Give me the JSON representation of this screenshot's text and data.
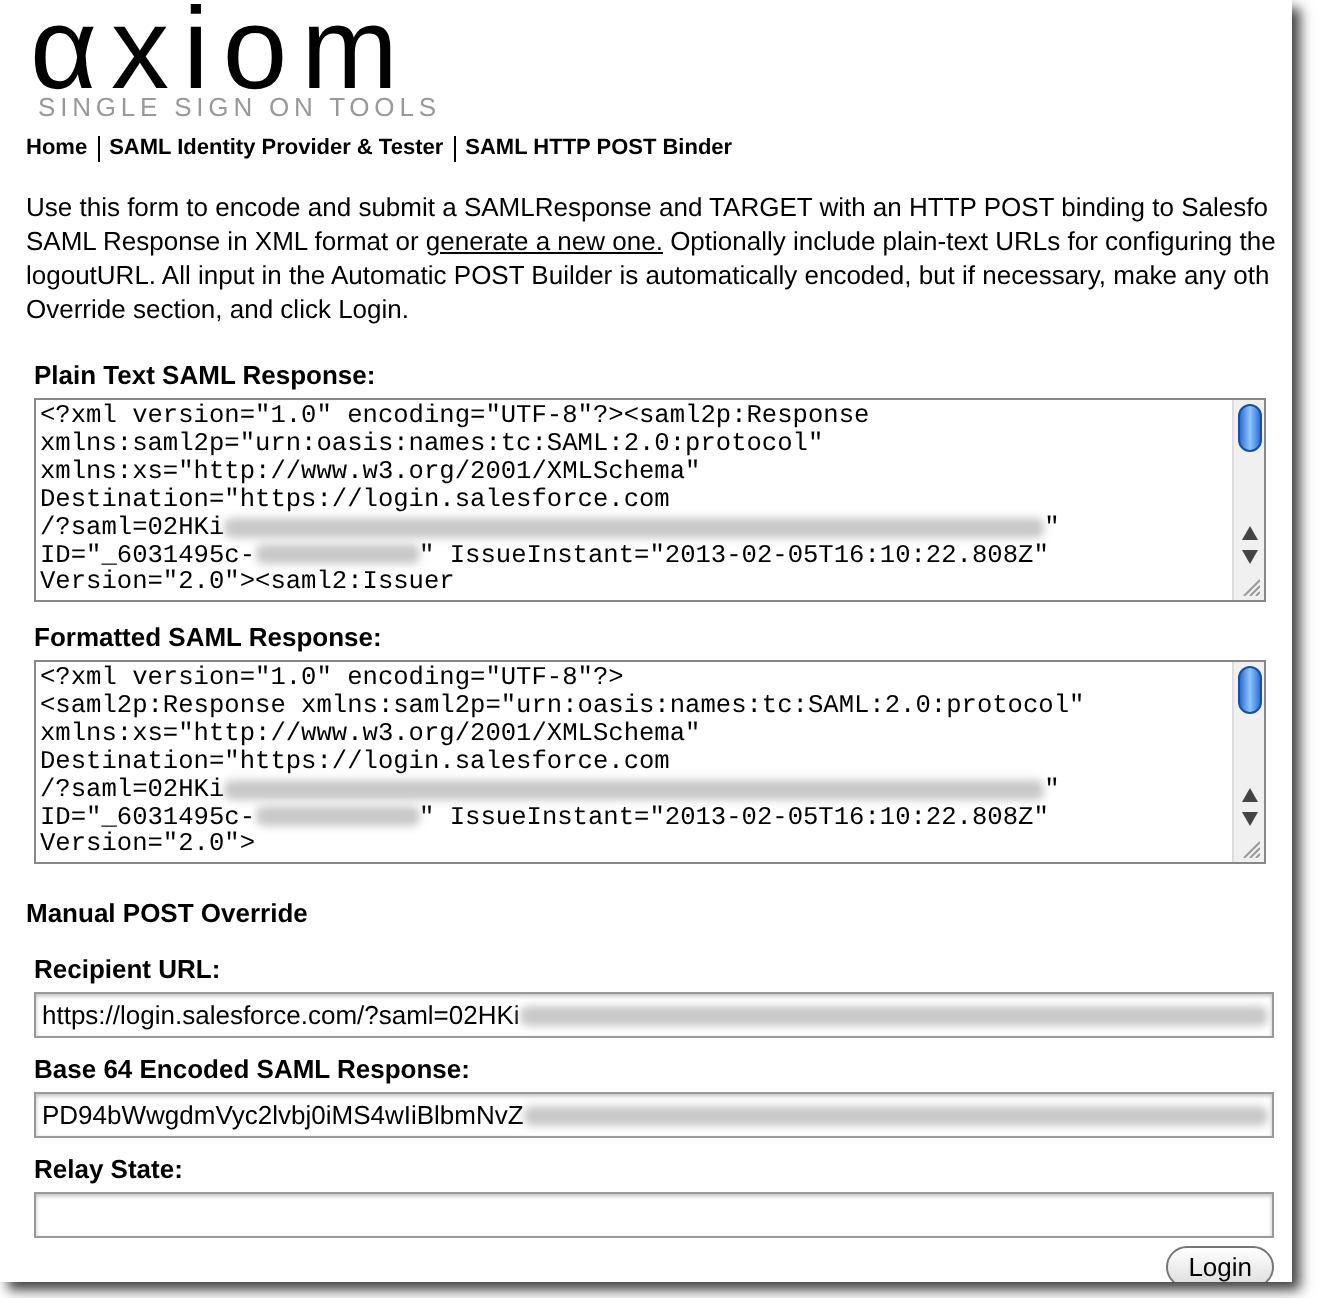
{
  "logo": {
    "wordmark": "αxiom",
    "tagline": "SINGLE SIGN ON TOOLS"
  },
  "nav": [
    "Home",
    "SAML Identity Provider & Tester",
    "SAML HTTP POST Binder"
  ],
  "intro": [
    {
      "text": "Use this form to encode and submit a SAMLResponse and TARGET with an HTTP POST binding to Salesfo"
    },
    {
      "before": "SAML Response in XML format or ",
      "link": "generate a new one.",
      "after": " Optionally include plain-text URLs for configuring the"
    },
    {
      "text": "logoutURL. All input in the Automatic POST Builder is automatically encoded, but if necessary, make any oth"
    },
    {
      "text": "Override section, and click Login."
    }
  ],
  "plain_response": {
    "label": "Plain Text SAML Response:",
    "lines": [
      {
        "kind": "plain",
        "text": "<?xml version=\"1.0\" encoding=\"UTF-8\"?><saml2p:Response"
      },
      {
        "kind": "plain",
        "text": "xmlns:saml2p=\"urn:oasis:names:tc:SAML:2.0:protocol\""
      },
      {
        "kind": "plain",
        "text": "xmlns:xs=\"http://www.w3.org/2001/XMLSchema\""
      },
      {
        "kind": "plain",
        "text": "Destination=\"https://login.salesforce.com"
      },
      {
        "kind": "redacted_url",
        "text": "/?saml=02HKi",
        "tail": "\""
      },
      {
        "kind": "redacted_id",
        "text": "ID=\"_6031495c-",
        "tail": "\" IssueInstant=\"2013-02-05T16:10:22.808Z\""
      },
      {
        "kind": "plain",
        "text": "Version=\"2.0\"><saml2:Issuer"
      }
    ]
  },
  "formatted_response": {
    "label": "Formatted SAML Response:",
    "lines": [
      {
        "kind": "plain",
        "text": "<?xml version=\"1.0\" encoding=\"UTF-8\"?>"
      },
      {
        "kind": "plain",
        "text": "<saml2p:Response xmlns:saml2p=\"urn:oasis:names:tc:SAML:2.0:protocol\""
      },
      {
        "kind": "plain",
        "text": "xmlns:xs=\"http://www.w3.org/2001/XMLSchema\""
      },
      {
        "kind": "plain",
        "text": "Destination=\"https://login.salesforce.com"
      },
      {
        "kind": "redacted_url",
        "text": "/?saml=02HKi",
        "tail": "\""
      },
      {
        "kind": "redacted_id",
        "text": "ID=\"_6031495c-",
        "tail": "\" IssueInstant=\"2013-02-05T16:10:22.808Z\""
      },
      {
        "kind": "plain",
        "text": "Version=\"2.0\">"
      }
    ]
  },
  "manual_override": {
    "title": "Manual POST Override",
    "fields": [
      {
        "label": "Recipient URL:",
        "value": "https://login.salesforce.com/?saml=02HKi",
        "redacted": true
      },
      {
        "label": "Base 64 Encoded SAML Response:",
        "value": "PD94bWwgdmVyc2lvbj0iMS4wIiBlbmNvZ",
        "redacted": true
      },
      {
        "label": "Relay State:",
        "redacted": false
      }
    ]
  },
  "login_button": "Login"
}
